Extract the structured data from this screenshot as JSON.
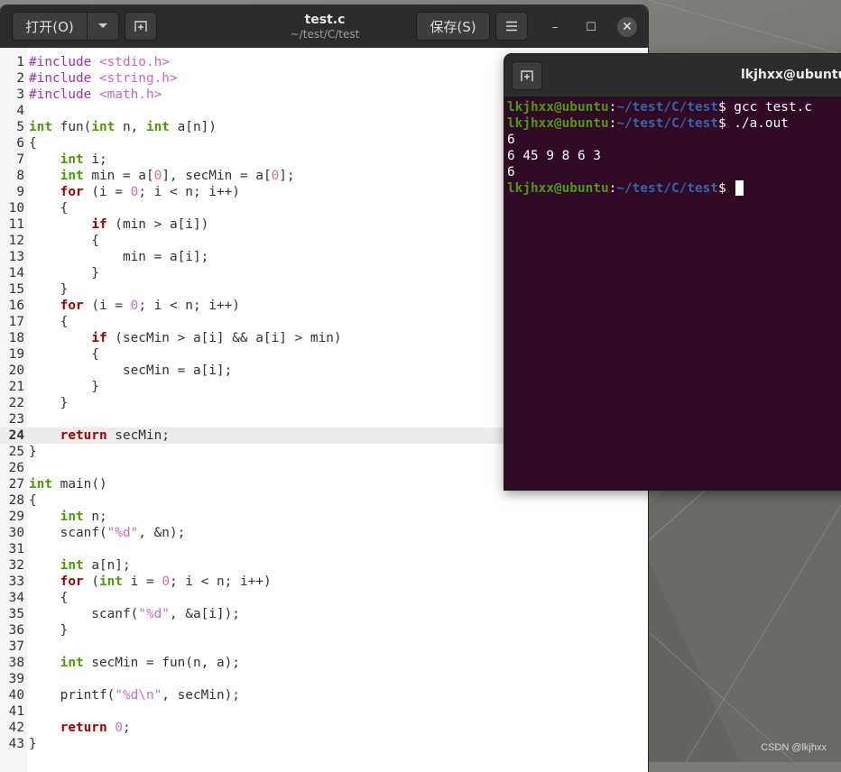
{
  "gedit": {
    "open_label": "打开(O)",
    "open_menu_icon": "chevron-down-icon",
    "new_tab_icon": "new-tab-icon",
    "title": "test.c",
    "subtitle": "~/test/C/test",
    "save_label": "保存(S)",
    "menu_icon": "hamburger-menu-icon",
    "min_glyph": "–",
    "max_glyph": "☐",
    "close_glyph": "✕",
    "current_line": 24,
    "lines": [
      {
        "n": "1",
        "tokens": [
          [
            "pp",
            "#include "
          ],
          [
            "pps",
            "<stdio.h>"
          ]
        ]
      },
      {
        "n": "2",
        "tokens": [
          [
            "pp",
            "#include "
          ],
          [
            "pps",
            "<string.h>"
          ]
        ]
      },
      {
        "n": "3",
        "tokens": [
          [
            "pp",
            "#include "
          ],
          [
            "pps",
            "<math.h>"
          ]
        ]
      },
      {
        "n": "4",
        "tokens": []
      },
      {
        "n": "5",
        "tokens": [
          [
            "ty",
            "int"
          ],
          [
            "t",
            " fun("
          ],
          [
            "ty",
            "int"
          ],
          [
            "t",
            " n, "
          ],
          [
            "ty",
            "int"
          ],
          [
            "t",
            " a[n])"
          ]
        ]
      },
      {
        "n": "6",
        "tokens": [
          [
            "t",
            "{"
          ]
        ]
      },
      {
        "n": "7",
        "tokens": [
          [
            "t",
            "    "
          ],
          [
            "ty",
            "int"
          ],
          [
            "t",
            " i;"
          ]
        ]
      },
      {
        "n": "8",
        "tokens": [
          [
            "t",
            "    "
          ],
          [
            "ty",
            "int"
          ],
          [
            "t",
            " min = a["
          ],
          [
            "num",
            "0"
          ],
          [
            "t",
            "], secMin = a["
          ],
          [
            "num",
            "0"
          ],
          [
            "t",
            "];"
          ]
        ]
      },
      {
        "n": "9",
        "tokens": [
          [
            "t",
            "    "
          ],
          [
            "kw",
            "for"
          ],
          [
            "t",
            " (i = "
          ],
          [
            "num",
            "0"
          ],
          [
            "t",
            "; i < n; i++)"
          ]
        ]
      },
      {
        "n": "10",
        "tokens": [
          [
            "t",
            "    {"
          ]
        ]
      },
      {
        "n": "11",
        "tokens": [
          [
            "t",
            "        "
          ],
          [
            "kw",
            "if"
          ],
          [
            "t",
            " (min > a[i])"
          ]
        ]
      },
      {
        "n": "12",
        "tokens": [
          [
            "t",
            "        {"
          ]
        ]
      },
      {
        "n": "13",
        "tokens": [
          [
            "t",
            "            min = a[i];"
          ]
        ]
      },
      {
        "n": "14",
        "tokens": [
          [
            "t",
            "        }"
          ]
        ]
      },
      {
        "n": "15",
        "tokens": [
          [
            "t",
            "    }"
          ]
        ]
      },
      {
        "n": "16",
        "tokens": [
          [
            "t",
            "    "
          ],
          [
            "kw",
            "for"
          ],
          [
            "t",
            " (i = "
          ],
          [
            "num",
            "0"
          ],
          [
            "t",
            "; i < n; i++)"
          ]
        ]
      },
      {
        "n": "17",
        "tokens": [
          [
            "t",
            "    {"
          ]
        ]
      },
      {
        "n": "18",
        "tokens": [
          [
            "t",
            "        "
          ],
          [
            "kw",
            "if"
          ],
          [
            "t",
            " (secMin > a[i] && a[i] > min)"
          ]
        ]
      },
      {
        "n": "19",
        "tokens": [
          [
            "t",
            "        {"
          ]
        ]
      },
      {
        "n": "20",
        "tokens": [
          [
            "t",
            "            secMin = a[i];"
          ]
        ]
      },
      {
        "n": "21",
        "tokens": [
          [
            "t",
            "        }"
          ]
        ]
      },
      {
        "n": "22",
        "tokens": [
          [
            "t",
            "    }"
          ]
        ]
      },
      {
        "n": "23",
        "tokens": []
      },
      {
        "n": "24",
        "tokens": [
          [
            "t",
            "    "
          ],
          [
            "kw",
            "return"
          ],
          [
            "t",
            " secMin;"
          ]
        ]
      },
      {
        "n": "25",
        "tokens": [
          [
            "t",
            "}"
          ]
        ]
      },
      {
        "n": "26",
        "tokens": []
      },
      {
        "n": "27",
        "tokens": [
          [
            "ty",
            "int"
          ],
          [
            "t",
            " main()"
          ]
        ]
      },
      {
        "n": "28",
        "tokens": [
          [
            "t",
            "{"
          ]
        ]
      },
      {
        "n": "29",
        "tokens": [
          [
            "t",
            "    "
          ],
          [
            "ty",
            "int"
          ],
          [
            "t",
            " n;"
          ]
        ]
      },
      {
        "n": "30",
        "tokens": [
          [
            "t",
            "    scanf("
          ],
          [
            "str",
            "\"%d\""
          ],
          [
            "t",
            ", &n);"
          ]
        ]
      },
      {
        "n": "31",
        "tokens": []
      },
      {
        "n": "32",
        "tokens": [
          [
            "t",
            "    "
          ],
          [
            "ty",
            "int"
          ],
          [
            "t",
            " a[n];"
          ]
        ]
      },
      {
        "n": "33",
        "tokens": [
          [
            "t",
            "    "
          ],
          [
            "kw",
            "for"
          ],
          [
            "t",
            " ("
          ],
          [
            "ty",
            "int"
          ],
          [
            "t",
            " i = "
          ],
          [
            "num",
            "0"
          ],
          [
            "t",
            "; i < n; i++)"
          ]
        ]
      },
      {
        "n": "34",
        "tokens": [
          [
            "t",
            "    {"
          ]
        ]
      },
      {
        "n": "35",
        "tokens": [
          [
            "t",
            "        scanf("
          ],
          [
            "str",
            "\"%d\""
          ],
          [
            "t",
            ", &a[i]);"
          ]
        ]
      },
      {
        "n": "36",
        "tokens": [
          [
            "t",
            "    }"
          ]
        ]
      },
      {
        "n": "37",
        "tokens": []
      },
      {
        "n": "38",
        "tokens": [
          [
            "t",
            "    "
          ],
          [
            "ty",
            "int"
          ],
          [
            "t",
            " secMin = fun(n, a);"
          ]
        ]
      },
      {
        "n": "39",
        "tokens": []
      },
      {
        "n": "40",
        "tokens": [
          [
            "t",
            "    printf("
          ],
          [
            "str",
            "\"%d\\n\""
          ],
          [
            "t",
            ", secMin);"
          ]
        ]
      },
      {
        "n": "41",
        "tokens": []
      },
      {
        "n": "42",
        "tokens": [
          [
            "t",
            "    "
          ],
          [
            "kw",
            "return"
          ],
          [
            "t",
            " "
          ],
          [
            "num",
            "0"
          ],
          [
            "t",
            ";"
          ]
        ]
      },
      {
        "n": "43",
        "tokens": [
          [
            "t",
            "}"
          ]
        ]
      }
    ]
  },
  "terminal": {
    "new_tab_icon": "new-tab-icon",
    "title": "lkjhxx@ubuntu: ~/test/C/test",
    "lines": [
      {
        "user": "lkjhxx@ubuntu",
        "sep": ":",
        "path": "~/test/C/test",
        "prompt": "$ ",
        "cmd": "gcc test.c"
      },
      {
        "user": "lkjhxx@ubuntu",
        "sep": ":",
        "path": "~/test/C/test",
        "prompt": "$ ",
        "cmd": "./a.out"
      },
      {
        "out": "6"
      },
      {
        "out": "6 45 9 8 6 3"
      },
      {
        "out": "6"
      },
      {
        "user": "lkjhxx@ubuntu",
        "sep": ":",
        "path": "~/test/C/test",
        "prompt": "$ ",
        "cmd": "",
        "cursor": true
      }
    ]
  },
  "watermark": "CSDN @lkjhxx"
}
